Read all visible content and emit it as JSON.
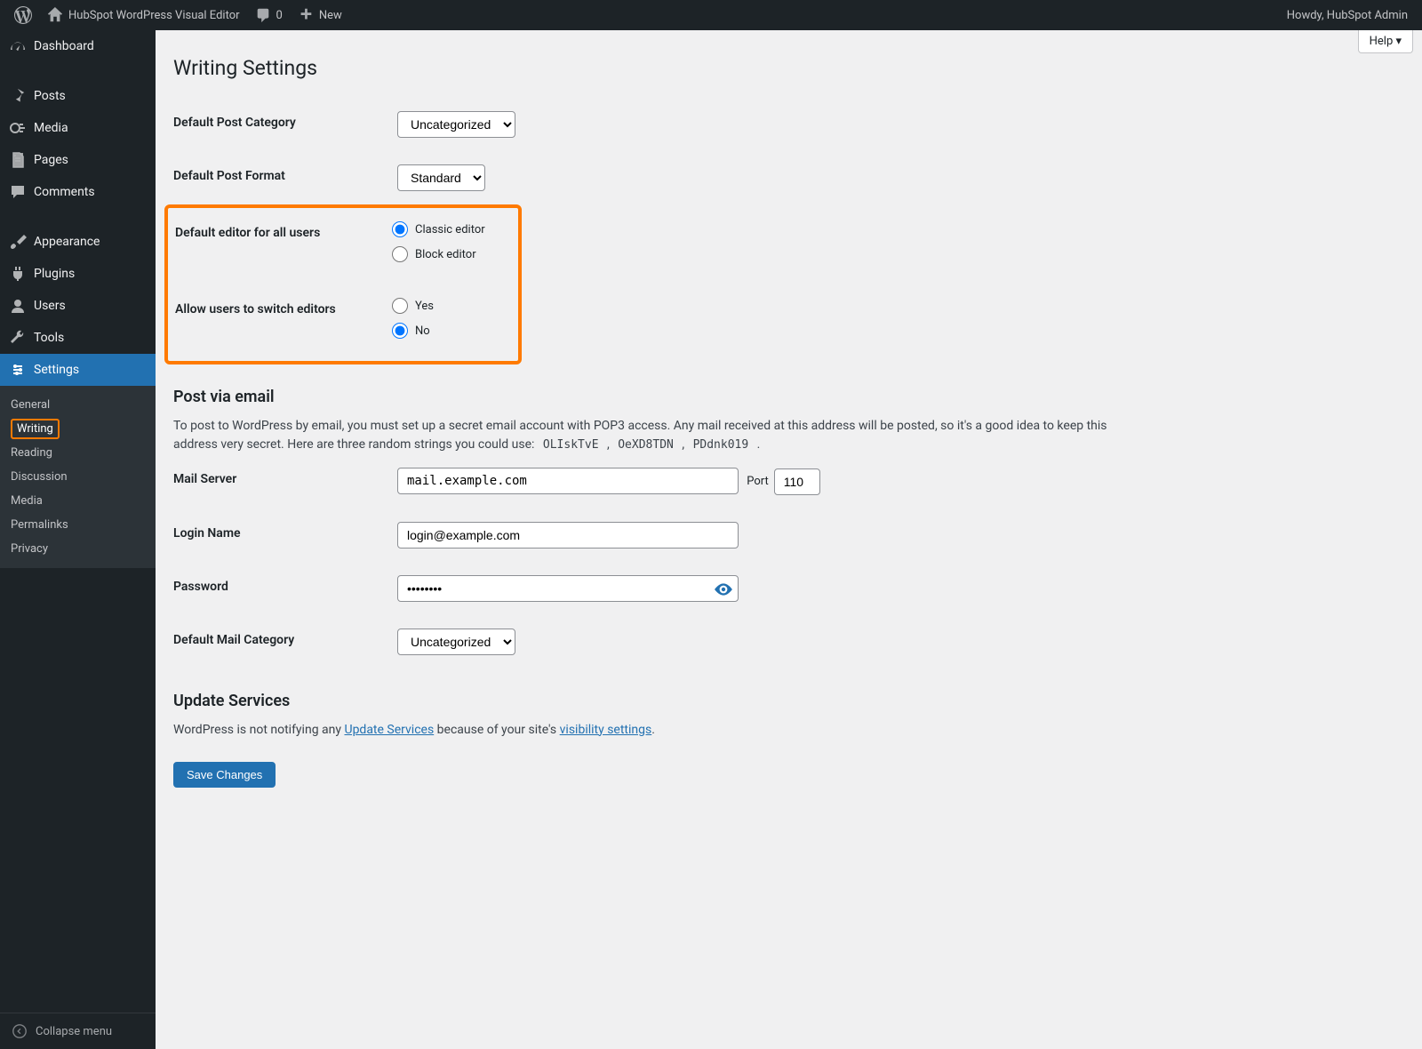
{
  "admin_bar": {
    "site_title": "HubSpot WordPress Visual Editor",
    "comments_count": "0",
    "new_label": "New",
    "greeting": "Howdy, HubSpot Admin"
  },
  "sidebar": {
    "items": [
      {
        "label": "Dashboard",
        "icon": "dashboard"
      },
      {
        "label": "Posts",
        "icon": "pin"
      },
      {
        "label": "Media",
        "icon": "media"
      },
      {
        "label": "Pages",
        "icon": "pages"
      },
      {
        "label": "Comments",
        "icon": "comment"
      },
      {
        "label": "Appearance",
        "icon": "brush"
      },
      {
        "label": "Plugins",
        "icon": "plug"
      },
      {
        "label": "Users",
        "icon": "user"
      },
      {
        "label": "Tools",
        "icon": "wrench"
      },
      {
        "label": "Settings",
        "icon": "settings"
      }
    ],
    "submenus": {
      "settings": [
        {
          "label": "General"
        },
        {
          "label": "Writing",
          "active": true
        },
        {
          "label": "Reading"
        },
        {
          "label": "Discussion"
        },
        {
          "label": "Media"
        },
        {
          "label": "Permalinks"
        },
        {
          "label": "Privacy"
        }
      ]
    },
    "collapse_label": "Collapse menu"
  },
  "page": {
    "title": "Writing Settings",
    "help_label": "Help",
    "labels": {
      "default_post_category": "Default Post Category",
      "default_post_format": "Default Post Format",
      "default_editor": "Default editor for all users",
      "allow_switch": "Allow users to switch editors",
      "mail_server": "Mail Server",
      "login_name": "Login Name",
      "password": "Password",
      "default_mail_category": "Default Mail Category",
      "port": "Port"
    },
    "values": {
      "default_post_category": "Uncategorized",
      "default_post_format": "Standard",
      "mail_server": "mail.example.com",
      "port": "110",
      "login_name": "login@example.com",
      "password_dots": "••••••••",
      "default_mail_category": "Uncategorized"
    },
    "editor_options": {
      "classic": "Classic editor",
      "block": "Block editor",
      "selected": "classic"
    },
    "switch_options": {
      "yes": "Yes",
      "no": "No",
      "selected": "no"
    },
    "post_via_email": {
      "heading": "Post via email",
      "desc_prefix": "To post to WordPress by email, you must set up a secret email account with POP3 access. Any mail received at this address will be posted, so it's a good idea to keep this address very secret. Here are three random strings you could use: ",
      "codes": [
        "OLIskTvE",
        "OeXD8TDN",
        "PDdnk019"
      ]
    },
    "update_services": {
      "heading": "Update Services",
      "text_prefix": "WordPress is not notifying any ",
      "link1": "Update Services",
      "text_mid": " because of your site's ",
      "link2": "visibility settings",
      "text_suffix": "."
    },
    "save_button": "Save Changes"
  }
}
